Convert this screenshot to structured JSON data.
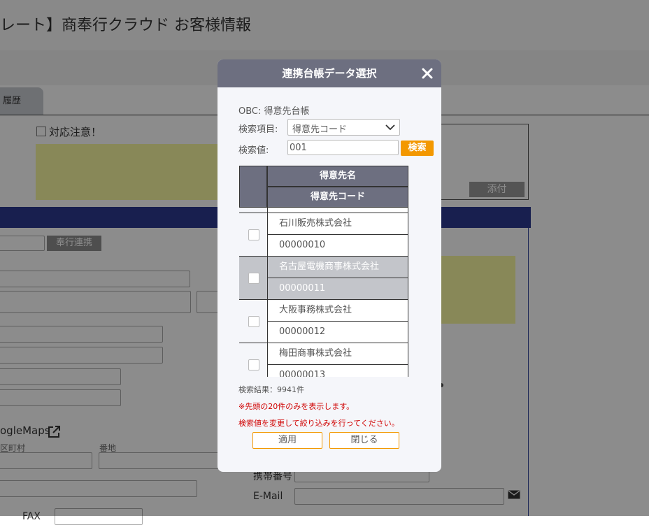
{
  "page": {
    "title": "レート】商奉行クラウド お客様情報",
    "tab_label": "履歴",
    "caution_label": "対応注意！",
    "attach_label": "添付",
    "hoko_button_label": "奉行連携",
    "googlemaps_label": "ogleMaps",
    "label_town": "区町村",
    "label_banchi": "番地",
    "label_mobile": "携帯番号",
    "label_email": "E-Mail",
    "label_fax": "FAX"
  },
  "modal": {
    "title": "連携台帳データ選択",
    "obc_label": "OBC: 得意先台帳",
    "search_field_label": "検索項目:",
    "search_field_value": "得意先コード",
    "search_value_label": "検索値:",
    "search_value": "001",
    "search_button": "検索",
    "table": {
      "header_name": "得意先名",
      "header_code": "得意先コード",
      "rows": [
        {
          "name": "石川販売株式会社",
          "code": "00000010",
          "selected": false
        },
        {
          "name": "名古屋電機商事株式会社",
          "code": "00000011",
          "selected": true
        },
        {
          "name": "大阪事務株式会社",
          "code": "00000012",
          "selected": false
        },
        {
          "name": "梅田商事株式会社",
          "code": "00000013",
          "selected": false
        }
      ]
    },
    "result_count": "検索結果：9941件",
    "note1": "※先頭の20件のみを表示します。",
    "note2": "検索値を変更して絞り込みを行ってください。",
    "apply_button": "適用",
    "close_button": "閉じる"
  }
}
